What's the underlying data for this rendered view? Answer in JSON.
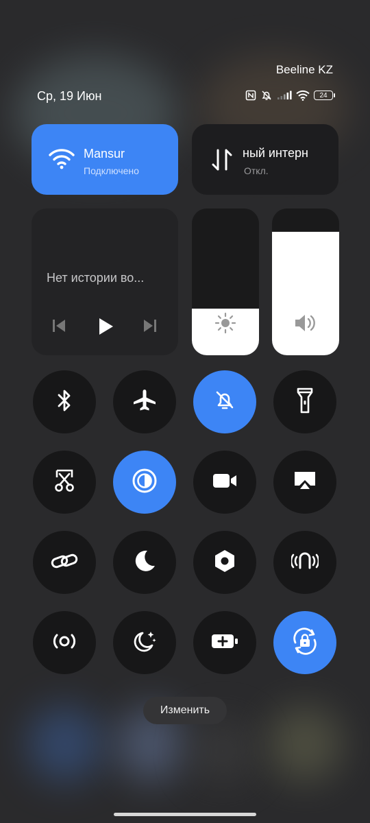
{
  "status_bar": {
    "carrier": "Beeline KZ",
    "date": "Ср, 19 Июн",
    "battery_level": "24",
    "icons": [
      "nfc-icon",
      "silent-bell-icon",
      "signal-icon",
      "wifi-icon",
      "battery-icon"
    ]
  },
  "wifi_tile": {
    "name": "Mansur",
    "status": "Подключено",
    "active": true
  },
  "data_tile": {
    "name": "ный интерн",
    "status": "Откл.",
    "active": false
  },
  "media_tile": {
    "message": "Нет истории во..."
  },
  "sliders": {
    "brightness": {
      "level_percent": 32,
      "icon": "sun-icon"
    },
    "volume": {
      "level_percent": 84,
      "icon": "speaker-icon"
    }
  },
  "toggles": [
    {
      "id": "bluetooth",
      "icon": "bluetooth-icon",
      "active": false
    },
    {
      "id": "airplane",
      "icon": "airplane-icon",
      "active": false
    },
    {
      "id": "silent",
      "icon": "silent-bell-icon",
      "active": true
    },
    {
      "id": "flashlight",
      "icon": "flashlight-icon",
      "active": false
    },
    {
      "id": "screenshot",
      "icon": "scissors-icon",
      "active": false
    },
    {
      "id": "reading",
      "icon": "reading-mode-icon",
      "active": true
    },
    {
      "id": "screen-record",
      "icon": "video-camera-icon",
      "active": false
    },
    {
      "id": "cast",
      "icon": "screen-cast-icon",
      "active": false
    },
    {
      "id": "link",
      "icon": "link-icon",
      "active": false
    },
    {
      "id": "dark-mode",
      "icon": "moon-icon",
      "active": false
    },
    {
      "id": "settings",
      "icon": "hexagon-icon",
      "active": false
    },
    {
      "id": "nfc",
      "icon": "nfc-signal-icon",
      "active": false
    },
    {
      "id": "hotspot",
      "icon": "hotspot-icon",
      "active": false
    },
    {
      "id": "dnd",
      "icon": "moon-stars-icon",
      "active": false
    },
    {
      "id": "battery-saver",
      "icon": "battery-plus-icon",
      "active": false
    },
    {
      "id": "rotation-lock",
      "icon": "rotation-lock-icon",
      "active": true
    }
  ],
  "edit_button": {
    "label": "Изменить"
  }
}
